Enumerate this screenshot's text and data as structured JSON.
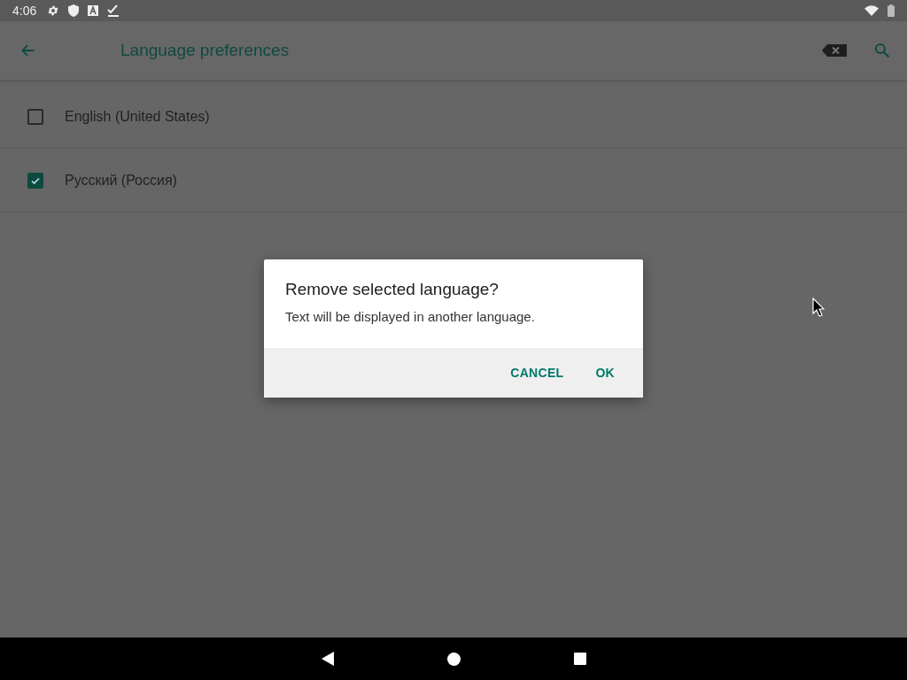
{
  "status_bar": {
    "time": "4:06"
  },
  "toolbar": {
    "title": "Language preferences"
  },
  "languages": [
    {
      "label": "English (United States)",
      "checked": false
    },
    {
      "label": "Русский (Россия)",
      "checked": true
    }
  ],
  "dialog": {
    "title": "Remove selected language?",
    "message": "Text will be displayed in another language.",
    "buttons": [
      "CANCEL",
      "OK"
    ]
  }
}
